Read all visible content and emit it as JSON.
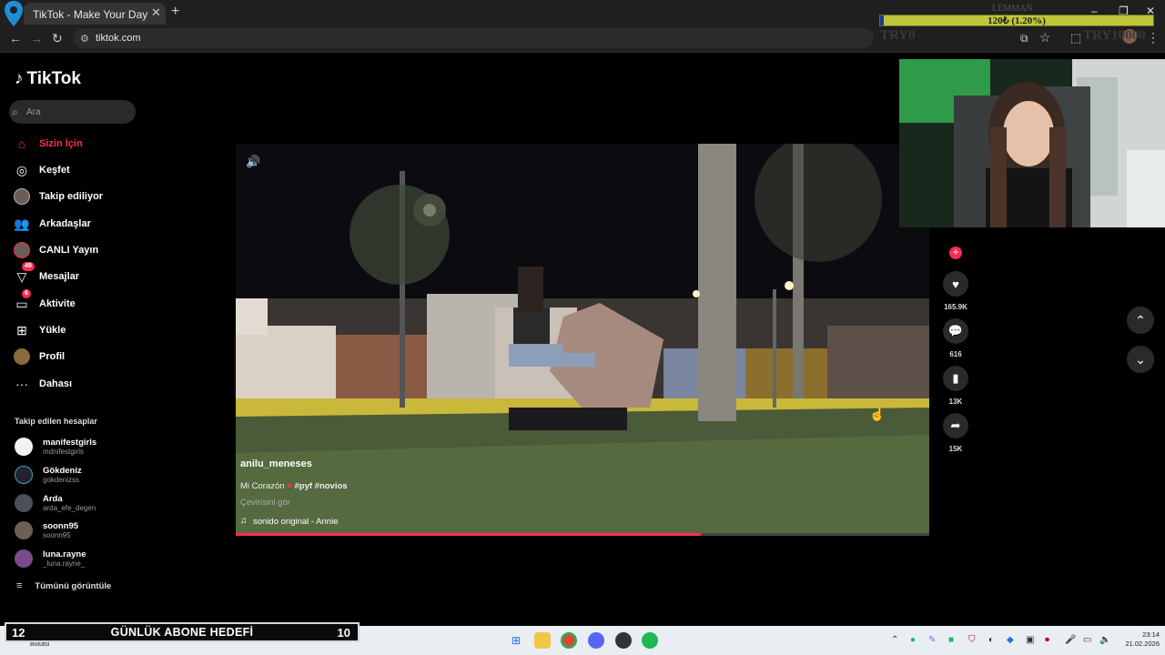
{
  "browser": {
    "tab_title": "TikTok - Make Your Day",
    "url": "tiktok.com",
    "tab_close": "✕",
    "new_tab": "+",
    "window_controls": [
      "–",
      "❐",
      "✕"
    ]
  },
  "donation_goal": {
    "top_label": "LEMMAN",
    "bar_text": "120₺ (1.20%)",
    "progress_percent": 1.2,
    "min_label": "TRY0",
    "max_label": "TRY10000"
  },
  "sidebar": {
    "logo": "TikTok",
    "search_placeholder": "Ara",
    "items": [
      {
        "label": "Sizin İçin",
        "icon": "home-icon",
        "active": true
      },
      {
        "label": "Keşfet",
        "icon": "compass-icon"
      },
      {
        "label": "Takip ediliyor",
        "icon": "following-avatar"
      },
      {
        "label": "Arkadaşlar",
        "icon": "friends-icon"
      },
      {
        "label": "CANLI Yayın",
        "icon": "live-avatar"
      },
      {
        "label": "Mesajlar",
        "icon": "messages-icon",
        "badge": "49"
      },
      {
        "label": "Aktivite",
        "icon": "activity-icon",
        "badge": "6"
      },
      {
        "label": "Yükle",
        "icon": "upload-icon"
      },
      {
        "label": "Profil",
        "icon": "profile-avatar"
      },
      {
        "label": "Dahası",
        "icon": "more-icon"
      }
    ],
    "following_title": "Takip edilen hesaplar",
    "accounts": [
      {
        "name": "manifestgirls",
        "handle": "mdnifestgirls"
      },
      {
        "name": "Gökdeniz",
        "handle": "gokdenizss"
      },
      {
        "name": "Arda",
        "handle": "arda_efe_degen"
      },
      {
        "name": "soonn95",
        "handle": "soonn95"
      },
      {
        "name": "luna.rayne",
        "handle": "_luna.rayne_"
      }
    ],
    "see_all": "Tümünü görüntüle"
  },
  "video": {
    "author": "anilu_meneses",
    "caption": "Mi Corazón",
    "tags": "#pyf #novios",
    "translate": "Çevirisini gör",
    "music": "sonido original - Annie",
    "progress_percent": 67
  },
  "actions": {
    "likes": "165.9K",
    "comments": "616",
    "bookmarks": "13K",
    "shares": "15K"
  },
  "sub_goal": {
    "current": "12",
    "title": "GÜNLÜK ABONE HEDEFİ",
    "target": "10",
    "weather": "Bulutlu"
  },
  "taskbar": {
    "time": "23:14",
    "date": "21.02.2026"
  },
  "colors": {
    "accent": "#fe2c55",
    "goal_bar": "#bfc63a",
    "taskbar": "#e9eef3"
  }
}
